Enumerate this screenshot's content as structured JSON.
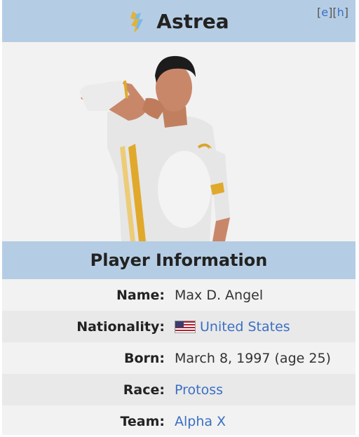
{
  "header": {
    "title": "Astrea",
    "race_icon": "protoss-icon",
    "edit_links": {
      "edit": "e",
      "history": "h"
    }
  },
  "section": {
    "title": "Player Information"
  },
  "rows": [
    {
      "label": "Name:",
      "value": "Max D. Angel"
    },
    {
      "label": "Nationality:",
      "value": "United States",
      "flag": "us-flag-icon"
    },
    {
      "label": "Born:",
      "value": "March 8, 1997 (age 25)"
    },
    {
      "label": "Race:",
      "value": "Protoss"
    },
    {
      "label": "Team:",
      "value": "Alpha X"
    }
  ],
  "colors": {
    "header_bg": "#b5cde4",
    "link": "#3a6fc4",
    "row_alt": "#e9e9e9"
  }
}
